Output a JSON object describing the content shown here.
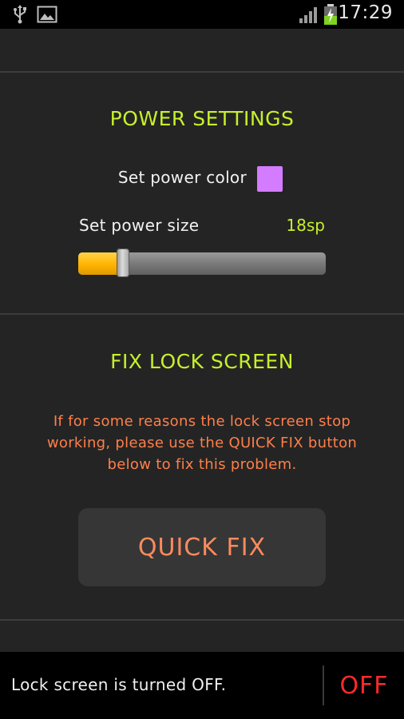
{
  "status_bar": {
    "time": "17:29",
    "icons": [
      "usb-icon",
      "gallery-icon",
      "signal-icon",
      "battery-charging-icon"
    ]
  },
  "power_settings": {
    "title": "POWER SETTINGS",
    "color_label": "Set power color",
    "color_value": "#d37cff",
    "size_label": "Set power size",
    "size_value": "18sp",
    "size_slider_fraction": 0.18
  },
  "fix_lock_screen": {
    "title": "FIX LOCK SCREEN",
    "description": "If for some reasons the lock screen stop working, please use the QUICK FIX button below to fix this problem.",
    "button_label": "QUICK FIX"
  },
  "bottom_bar": {
    "status_text": "Lock screen is turned OFF.",
    "toggle_label": "OFF"
  },
  "colors": {
    "accent_green": "#c6f02c",
    "warning_orange": "#ff7f4a",
    "off_red": "#ff2a2a",
    "slider_fill": "#ffb300"
  }
}
